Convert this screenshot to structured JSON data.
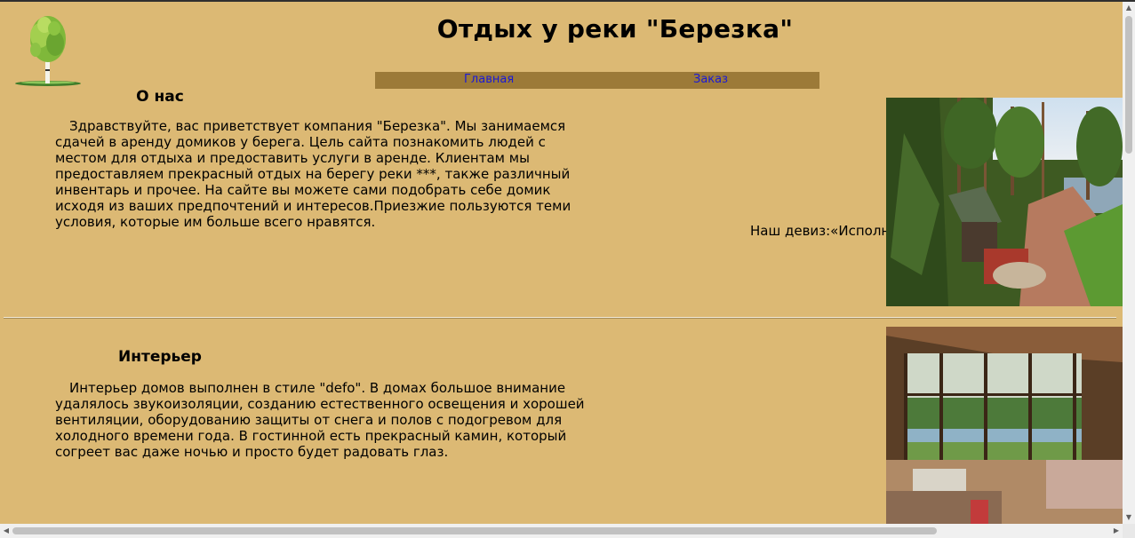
{
  "header": {
    "title": "Отдых у реки \"Березка\"",
    "logo": "birch-tree-icon"
  },
  "nav": {
    "home_label": "Главная",
    "order_label": "Заказ"
  },
  "about": {
    "heading": "О нас",
    "text": "Здравствуйте, вас приветствует компания \"Березка\". Мы занимаемся сдачей в аренду домиков у берега. Цель сайта познакомить людей с местом для отдыха и предоставить услуги в аренде. Клиентам мы предоставляем прекрасный отдых на берегу реки ***, также различный инвентарь и прочее. На сайте вы можете сами подобрать себе домик исходя из ваших предпочтений и интересов.Приезжие пользуются теми условия, которые им больше всего нравятся.",
    "motto": "Наш девиз:«Исполни»"
  },
  "interior": {
    "heading": "Интерьер",
    "text": "Интерьер домов выполнен в стиле \"defo\". В домах большое внимание удалялось звукоизоляции, созданию естественного освещения и хорошей вентиляции, оборудованию защиты от снега и полов с подогревом для холодного времени года. В гостинной есть прекрасный камин, который согреет вас даже ночью и просто будет радовать глаз."
  },
  "colors": {
    "background": "#dcb974",
    "navbar": "#9c7a38",
    "link": "#1a1ad6"
  }
}
